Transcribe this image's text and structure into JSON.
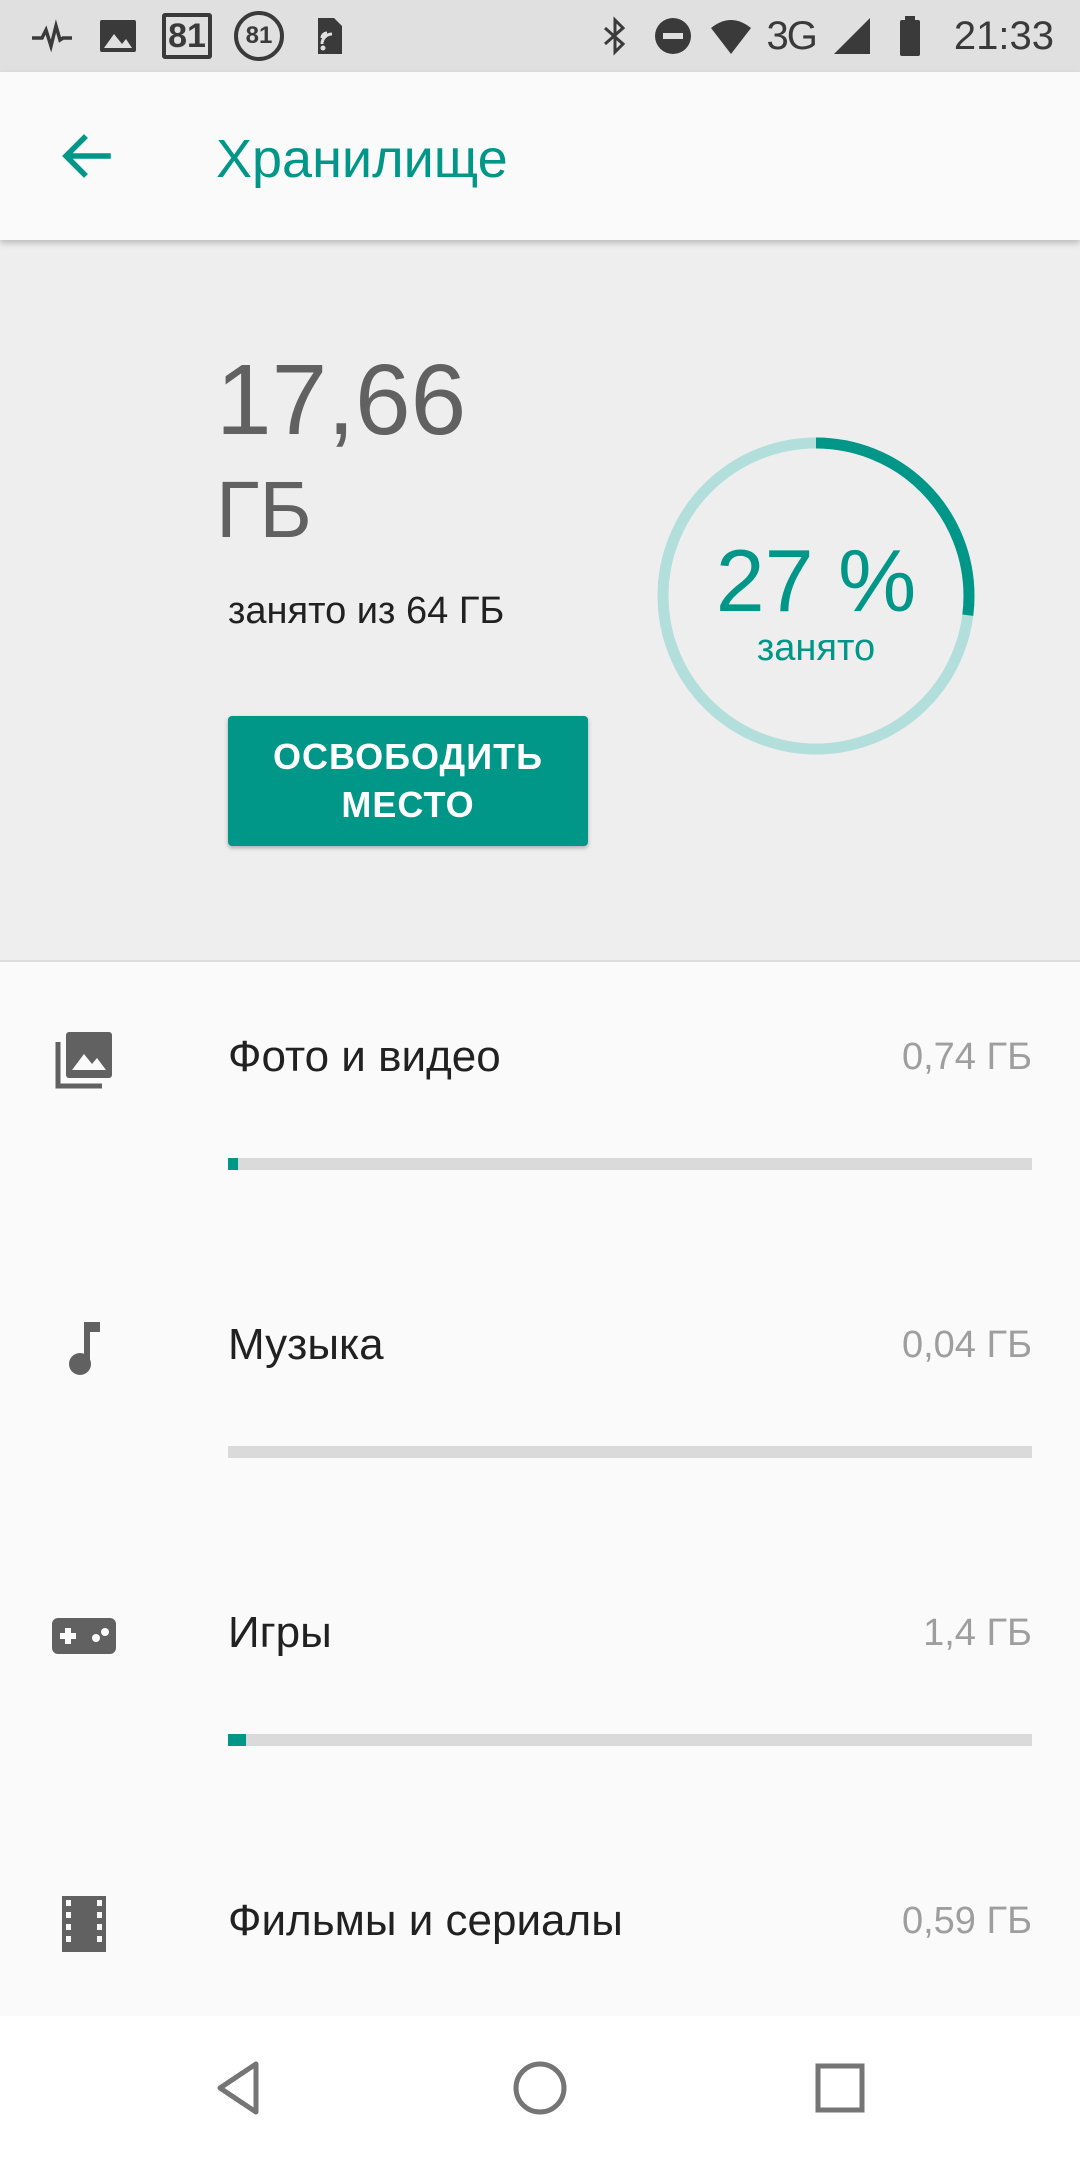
{
  "status_bar": {
    "box_badge": "81",
    "circle_badge": "81",
    "network": "3G",
    "time": "21:33"
  },
  "header": {
    "title": "Хранилище"
  },
  "summary": {
    "used_value": "17,66",
    "used_unit": "ГБ",
    "used_of": "занято из 64 ГБ",
    "free_button_label": "ОСВОБОДИТЬ МЕСТО",
    "ring_percent_text": "27 %",
    "ring_label": "занято",
    "ring_fraction": 0.27
  },
  "categories": [
    {
      "label": "Фото и видео",
      "size": "0,74 ГБ",
      "fraction": 0.012,
      "icon": "photo-library-icon"
    },
    {
      "label": "Музыка",
      "size": "0,04 ГБ",
      "fraction": 0.0,
      "icon": "music-note-icon"
    },
    {
      "label": "Игры",
      "size": "1,4 ГБ",
      "fraction": 0.022,
      "icon": "gamepad-icon"
    },
    {
      "label": "Фильмы и сериалы",
      "size": "0,59 ГБ",
      "fraction": 0.009,
      "icon": "movie-icon"
    }
  ],
  "colors": {
    "accent": "#009688",
    "ring_track": "#b2dfdb",
    "bar_track": "#dadada"
  }
}
